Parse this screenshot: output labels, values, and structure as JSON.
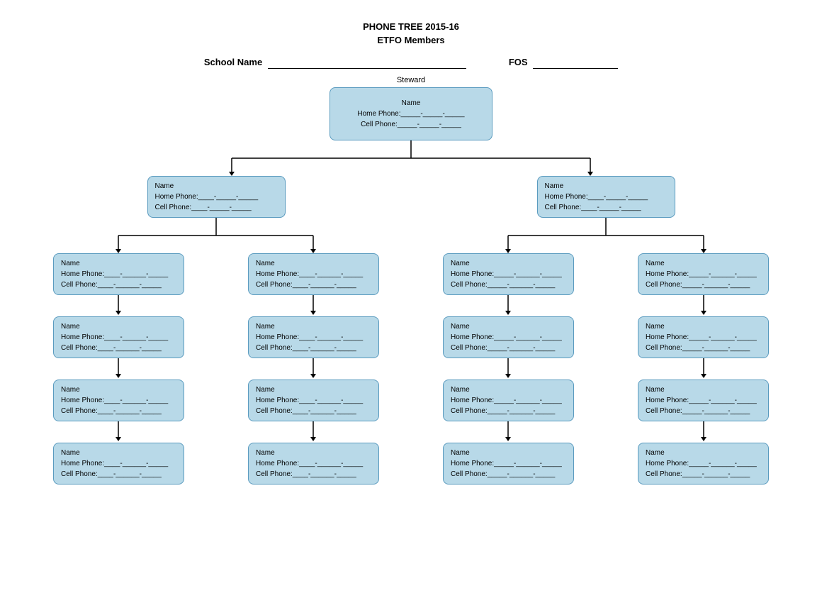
{
  "header": {
    "title": "PHONE TREE 2015-16",
    "subtitle": "ETFO Members",
    "school_label": "School Name",
    "fos_label": "FOS"
  },
  "tree": {
    "steward_label": "Steward",
    "root": {
      "name": "Name",
      "home": "Home Phone:_____-_____-_____",
      "cell": "Cell Phone:_____-_____-_____"
    },
    "level1": [
      {
        "name": "Name",
        "home": "Home Phone:____-_____-_____",
        "cell": "Cell Phone:____-_____-_____"
      },
      {
        "name": "Name",
        "home": "Home Phone:____-_____-_____",
        "cell": "Cell Phone:____-_____-_____"
      }
    ],
    "level2": [
      {
        "name": "Name",
        "home": "Home Phone:____-______-_____",
        "cell": "Cell Phone:____-______-_____"
      },
      {
        "name": "Name",
        "home": "Home Phone:____-______-_____",
        "cell": "Cell Phone:____-______-_____"
      },
      {
        "name": "Name",
        "home": "Home Phone:_____-______-_____",
        "cell": "Cell Phone:_____-______-_____"
      },
      {
        "name": "Name",
        "home": "Home Phone:_____-______-_____",
        "cell": "Cell Phone:_____-______-_____"
      }
    ],
    "level3": [
      {
        "name": "Name",
        "home": "Home Phone:____-______-_____",
        "cell": "Cell Phone:____-______-_____"
      },
      {
        "name": "Name",
        "home": "Home Phone:____-______-_____",
        "cell": "Cell Phone:____-______-_____"
      },
      {
        "name": "Name",
        "home": "Home Phone:_____-______-_____",
        "cell": "Cell Phone:_____-______-_____"
      },
      {
        "name": "Name",
        "home": "Home Phone:_____-______-_____",
        "cell": "Cell Phone:_____-______-_____"
      }
    ],
    "level4": [
      {
        "name": "Name",
        "home": "Home Phone:____-______-_____",
        "cell": "Cell Phone:____-______-_____"
      },
      {
        "name": "Name",
        "home": "Home Phone:____-______-_____",
        "cell": "Cell Phone:____-______-_____"
      },
      {
        "name": "Name",
        "home": "Home Phone:_____-______-_____",
        "cell": "Cell Phone:_____-______-_____"
      },
      {
        "name": "Name",
        "home": "Home Phone:_____-______-_____",
        "cell": "Cell Phone:_____-______-_____"
      }
    ],
    "level5": [
      {
        "name": "Name",
        "home": "Home Phone:____-______-_____",
        "cell": "Cell Phone:____-______-_____"
      },
      {
        "name": "Name",
        "home": "Home Phone:____-______-_____",
        "cell": "Cell Phone:____-______-_____"
      },
      {
        "name": "Name",
        "home": "Home Phone:_____-______-_____",
        "cell": "Cell Phone:_____-______-_____"
      },
      {
        "name": "Name",
        "home": "Home Phone:_____-______-_____",
        "cell": "Cell Phone:_____-______-_____"
      }
    ]
  }
}
